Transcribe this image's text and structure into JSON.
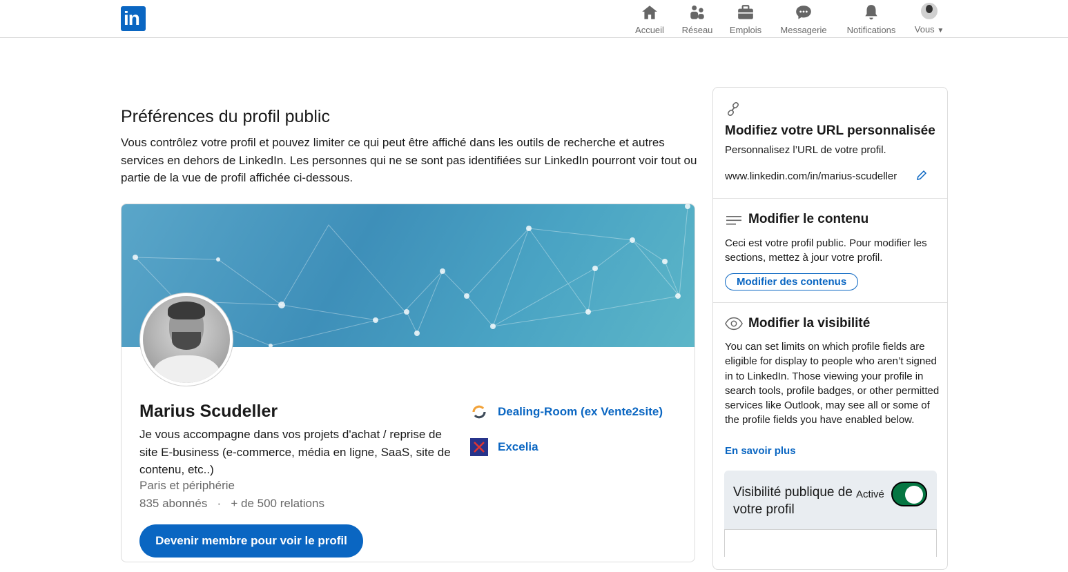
{
  "nav": {
    "logo_text": "in",
    "items": [
      {
        "label": "Accueil",
        "icon": "home-icon"
      },
      {
        "label": "Réseau",
        "icon": "network-icon"
      },
      {
        "label": "Emplois",
        "icon": "briefcase-icon"
      },
      {
        "label": "Messagerie",
        "icon": "messaging-icon"
      },
      {
        "label": "Notifications",
        "icon": "bell-icon"
      },
      {
        "label": "Vous",
        "icon": "avatar"
      }
    ]
  },
  "main": {
    "title": "Préférences du profil public",
    "description": "Vous contrôlez votre profil et pouvez limiter ce qui peut être affiché dans les outils de recherche et autres services en dehors de LinkedIn. Les personnes qui ne se sont pas identifiées sur LinkedIn pourront voir tout ou partie de la vue de profil affichée ci-dessous."
  },
  "profile": {
    "name": "Marius Scudeller",
    "headline": "Je vous accompagne dans vos projets d'achat / reprise de site E-business (e-commerce, média en ligne, SaaS, site de contenu, etc..)",
    "location": "Paris et périphérie",
    "followers": "835 abonnés",
    "separator": "·",
    "connections": "+ de 500 relations",
    "join_button": "Devenir membre pour voir le profil",
    "orgs": [
      {
        "name": "Dealing-Room (ex Vente2site)",
        "icon": "dealing-room-logo"
      },
      {
        "name": "Excelia",
        "icon": "excelia-logo"
      }
    ]
  },
  "sidebar": {
    "url_section": {
      "title": "Modifiez votre URL personnalisée",
      "subtitle": "Personnalisez l’URL de votre profil.",
      "url": "www.linkedin.com/in/marius-scudeller"
    },
    "content_section": {
      "title": "Modifier le contenu",
      "text": "Ceci est votre profil public. Pour modifier les sections, mettez à jour votre profil.",
      "button": "Modifier des contenus"
    },
    "visibility_section": {
      "title": "Modifier la visibilité",
      "text": "You can set limits on which profile fields are eligible for display to people who aren’t signed in to LinkedIn. Those viewing your profile in search tools, profile badges, or other permitted services like Outlook, may see all or some of the profile fields you have enabled below.",
      "link": "En savoir plus",
      "toggle_label": "Visibilité publique de votre profil",
      "toggle_status": "Activé",
      "toggle_on": true
    }
  },
  "colors": {
    "brand": "#0a66c2",
    "toggle_on": "#057642"
  }
}
